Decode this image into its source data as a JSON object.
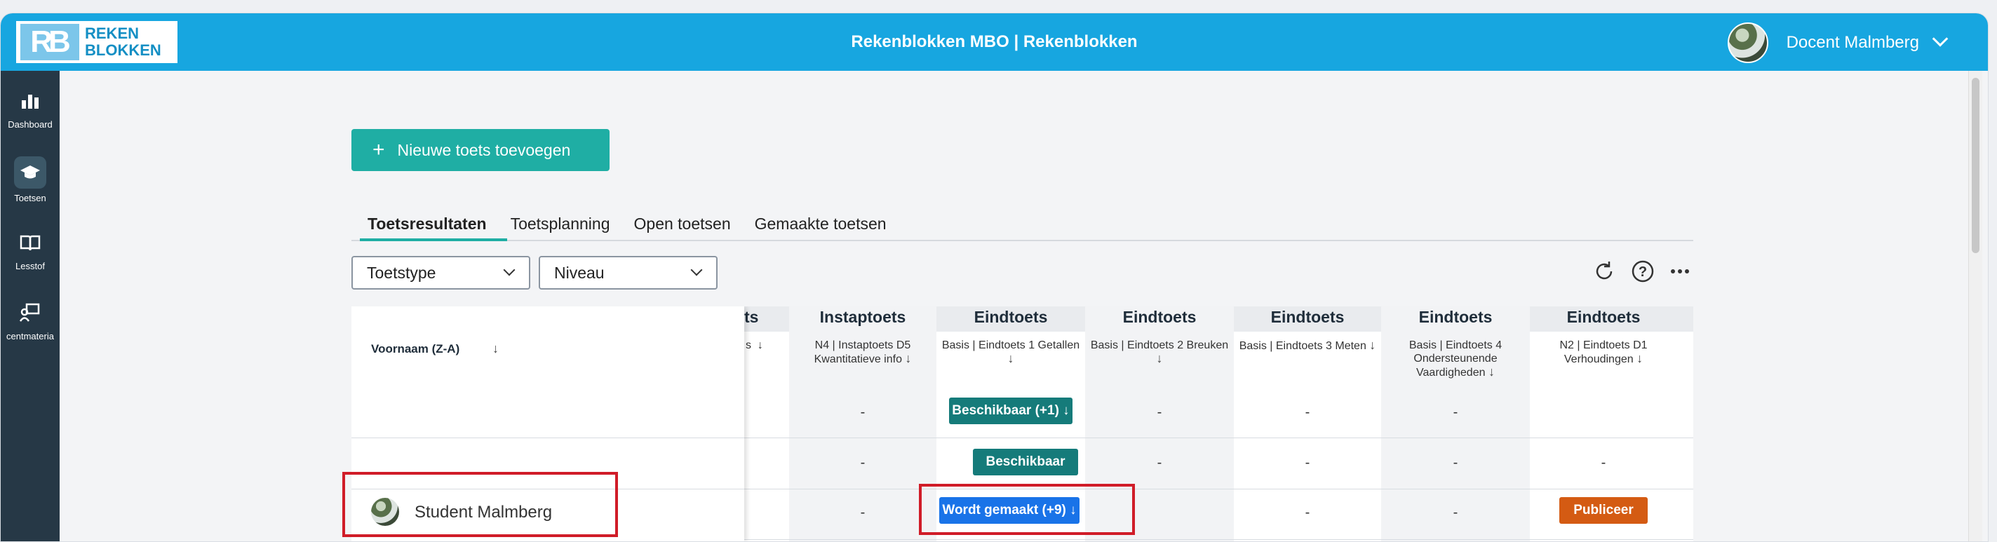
{
  "header": {
    "logo_mark": "RB",
    "logo_line1": "REKEN",
    "logo_line2": "BLOKKEN",
    "title": "Rekenblokken MBO | Rekenblokken",
    "user_name": "Docent Malmberg"
  },
  "sidebar": {
    "items": [
      {
        "label": "Dashboard",
        "icon": "bar-chart-icon"
      },
      {
        "label": "Toetsen",
        "icon": "graduation-cap-icon"
      },
      {
        "label": "Lesstof",
        "icon": "book-icon"
      },
      {
        "label": "centmateria",
        "icon": "teacher-board-icon"
      }
    ]
  },
  "toolbar": {
    "add_test_label": "Nieuwe toets toevoegen"
  },
  "tabs": [
    "Toetsresultaten",
    "Toetsplanning",
    "Open toetsen",
    "Gemaakte toetsen"
  ],
  "filters": {
    "type": "Toetstype",
    "level": "Niveau"
  },
  "table": {
    "name_header": "Voornaam (Z-A)",
    "partial_header": "ts",
    "columns": [
      {
        "title": "Instaptoets",
        "sub": "N4 | Instaptoets D5 Kwantitatieve info"
      },
      {
        "title": "Eindtoets",
        "sub": "Basis | Eindtoets 1 Getallen"
      },
      {
        "title": "Eindtoets",
        "sub": "Basis | Eindtoets 2 Breuken"
      },
      {
        "title": "Eindtoets",
        "sub": "Basis | Eindtoets 3 Meten"
      },
      {
        "title": "Eindtoets",
        "sub": "Basis | Eindtoets 4 Ondersteunende Vaardigheden"
      },
      {
        "title": "Eindtoets",
        "sub": "N2 | Eindtoets D1 Verhoudingen"
      }
    ],
    "rows": [
      {
        "name": "",
        "cells": [
          "-",
          "Beschikbaar (+1) ↓",
          "-",
          "-",
          "-",
          ""
        ]
      },
      {
        "name": "",
        "cells": [
          "-",
          "Beschikbaar",
          "-",
          "-",
          "-",
          "-"
        ]
      },
      {
        "name": "Student Malmberg",
        "cells": [
          "-",
          "Wordt gemaakt (+9) ↓",
          "",
          "-",
          "-",
          "Publiceer"
        ]
      }
    ],
    "dash": "-"
  },
  "colors": {
    "topbar": "#17a6e0",
    "sidebar": "#263846",
    "accent": "#1faea4",
    "badge_teal": "#157b7a",
    "badge_blue": "#1973e8",
    "badge_orange": "#d45b13",
    "highlight": "#d01c28"
  }
}
